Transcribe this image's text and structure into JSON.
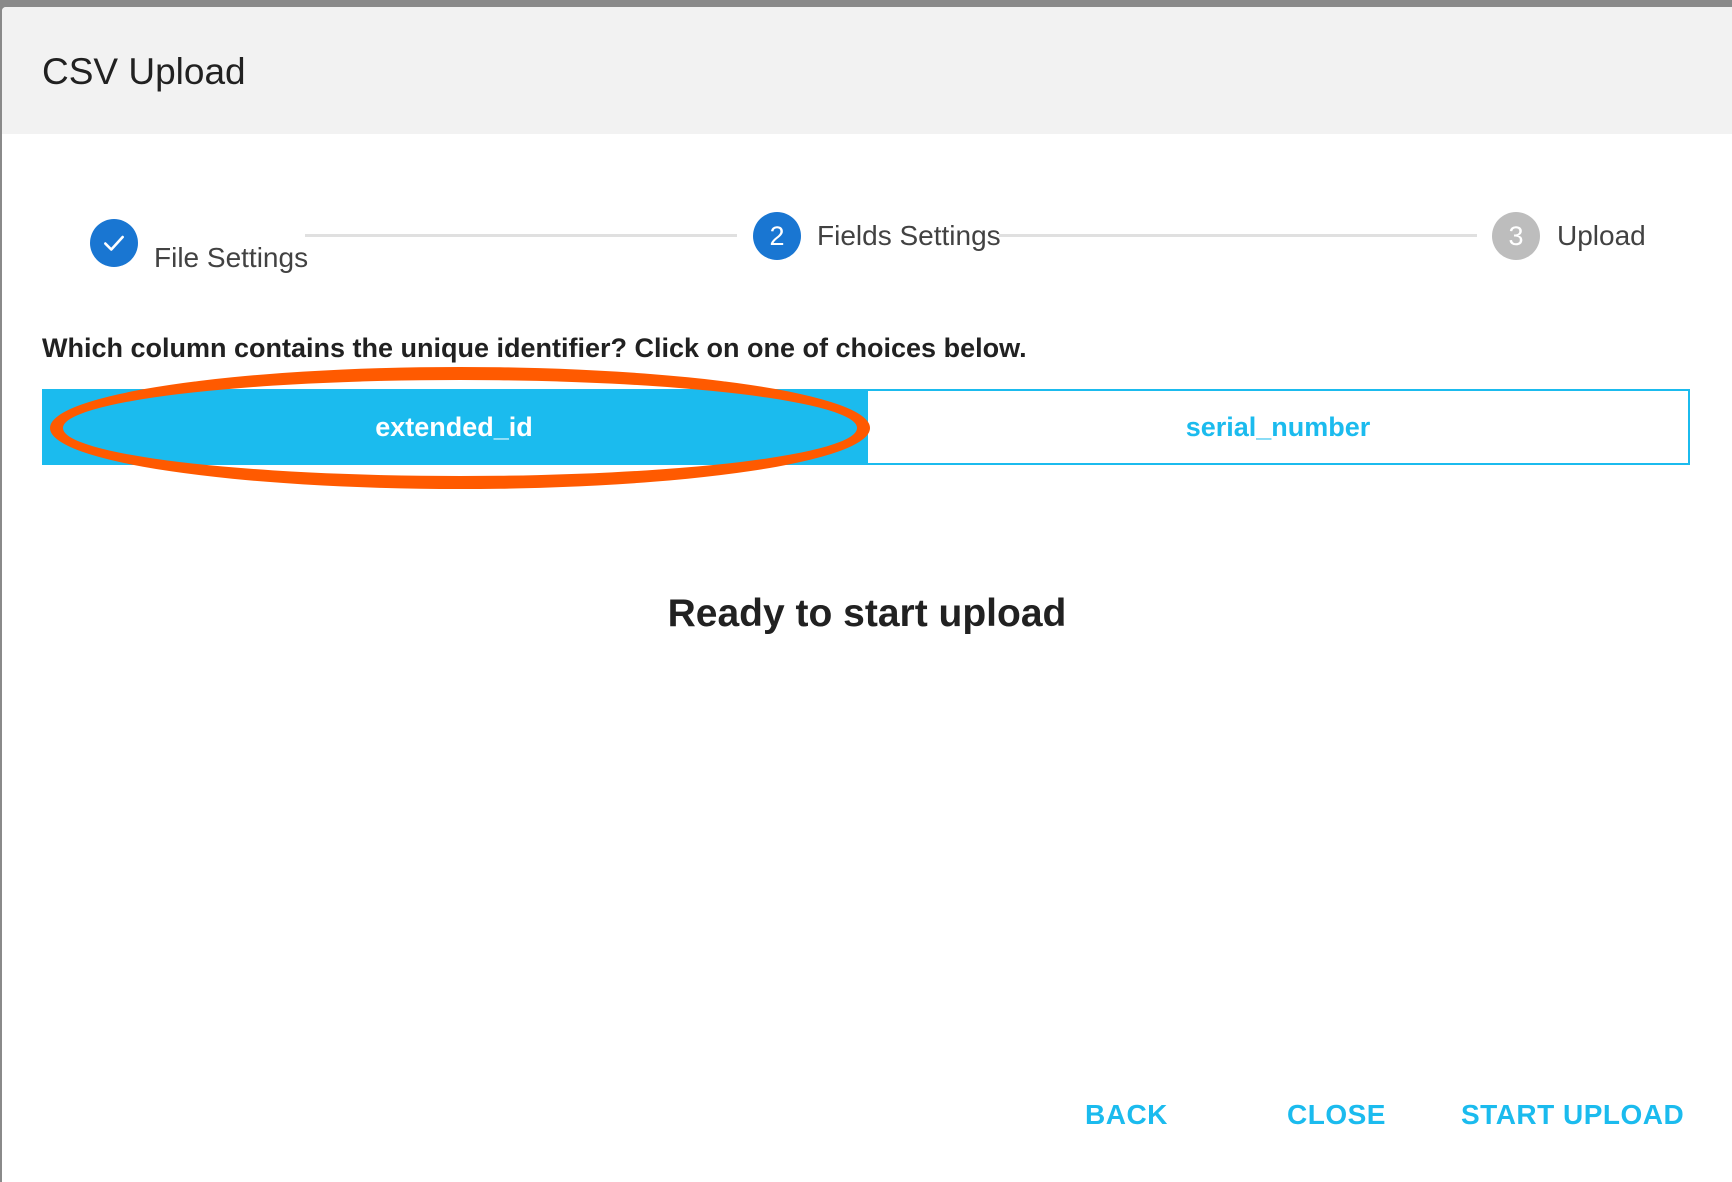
{
  "dialog": {
    "title": "CSV Upload"
  },
  "stepper": {
    "steps": [
      {
        "label": "File Settings",
        "number": "",
        "state": "done"
      },
      {
        "label": "Fields Settings",
        "number": "2",
        "state": "active"
      },
      {
        "label": "Upload",
        "number": "3",
        "state": "pending"
      }
    ]
  },
  "question": "Which column contains the unique identifier? Click on one of choices below.",
  "choices": [
    {
      "label": "extended_id",
      "selected": true
    },
    {
      "label": "serial_number",
      "selected": false
    }
  ],
  "status": "Ready to start upload",
  "actions": {
    "back": "BACK",
    "close": "CLOSE",
    "start_upload": "START UPLOAD"
  },
  "colors": {
    "accent": "#1bbbee",
    "step_active": "#1976d2",
    "step_pending": "#bdbdbd",
    "annotation": "#ff5a00"
  }
}
